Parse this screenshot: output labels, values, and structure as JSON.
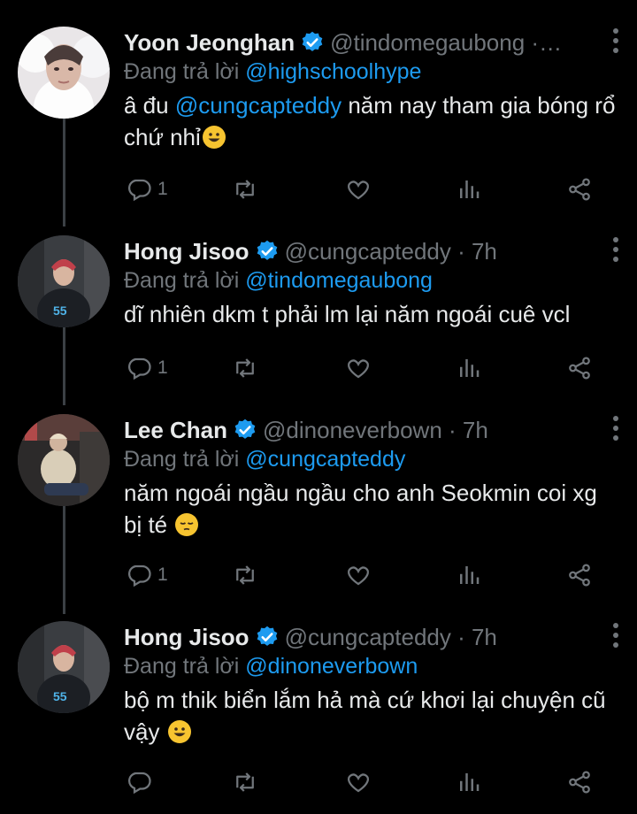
{
  "tweets": [
    {
      "name": "Yoon Jeonghan",
      "handle": "@tindomegaubong ·…",
      "reply_prefix": "Đang trả lời",
      "reply_to": "@highschoolhype",
      "text_pre": "â đu ",
      "text_mention": "@cungcapteddy",
      "text_post": " năm nay tham gia bóng rổ chứ nhỉ",
      "emoji": "grinning-face",
      "reply_count": "1",
      "avatar_style": "white-fur"
    },
    {
      "name": "Hong Jisoo",
      "handle": "@cungcapteddy · 7h",
      "reply_prefix": "Đang trả lời",
      "reply_to": "@tindomegaubong",
      "text_pre": "dĩ nhiên dkm t phải lm lại năm ngoái cuê vcl",
      "text_mention": "",
      "text_post": "",
      "emoji": "",
      "reply_count": "1",
      "avatar_style": "red-hair-jacket"
    },
    {
      "name": "Lee Chan",
      "handle": "@dinoneverbown · 7h",
      "reply_prefix": "Đang trả lời",
      "reply_to": "@cungcapteddy",
      "text_pre": "năm ngoái ngầu ngầu cho anh Seokmin coi xg bị té",
      "text_mention": "",
      "text_post": "",
      "emoji": "pensive-face",
      "reply_count": "1",
      "avatar_style": "sitting-chair"
    },
    {
      "name": "Hong Jisoo",
      "handle": "@cungcapteddy · 7h",
      "reply_prefix": "Đang trả lời",
      "reply_to": "@dinoneverbown",
      "text_pre": "bộ m thik biển lắm hả mà cứ khơi lại chuyện cũ vậy",
      "text_mention": "",
      "text_post": "",
      "emoji": "grinning-face",
      "reply_count": "",
      "avatar_style": "red-hair-jacket"
    }
  ],
  "icons": {
    "reply": "reply-icon",
    "retweet": "retweet-icon",
    "like": "heart-icon",
    "views": "analytics-icon",
    "share": "share-icon",
    "verified": "verified-badge-icon",
    "more": "more-options-icon"
  },
  "colors": {
    "background": "#000000",
    "text": "#e7e9ea",
    "secondary": "#71767b",
    "accent": "#1d9bf0",
    "thread_line": "#3b4045"
  }
}
